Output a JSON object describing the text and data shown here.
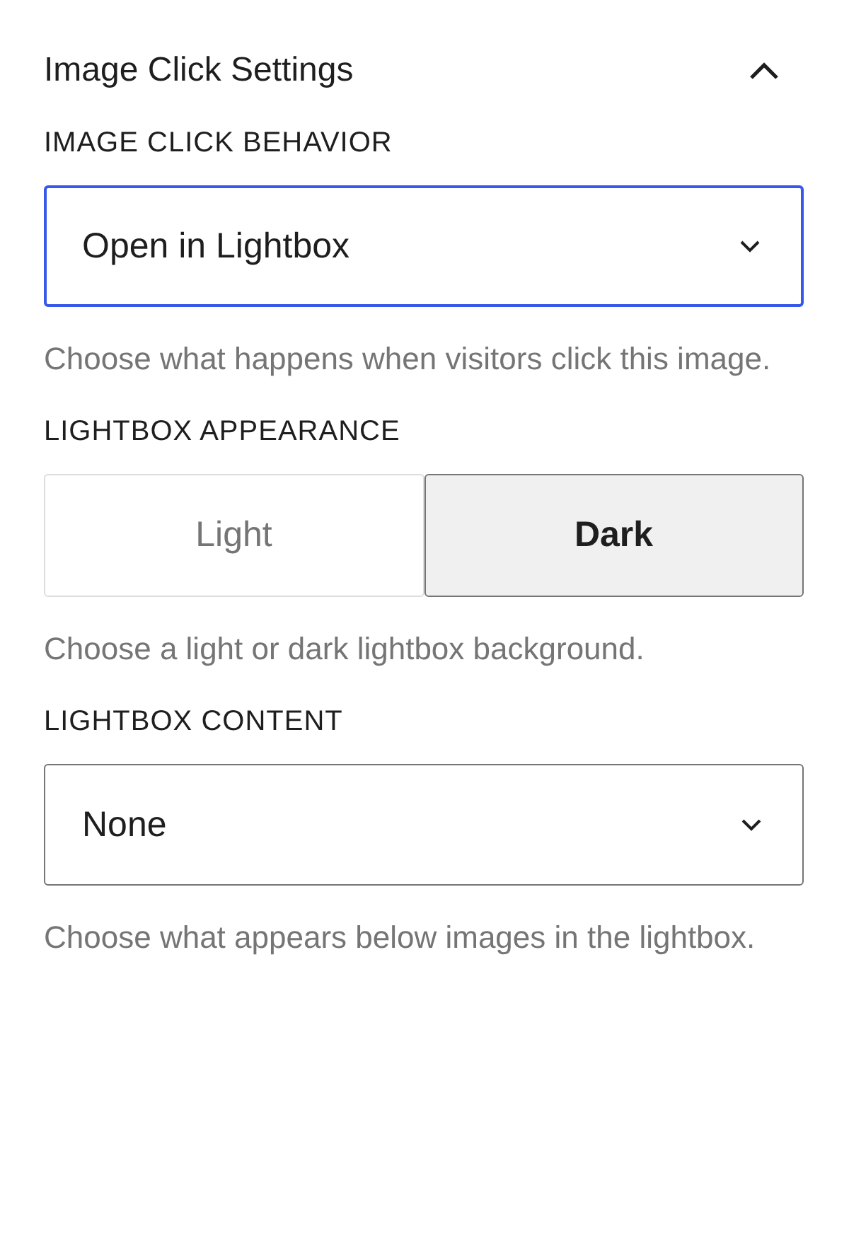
{
  "panel": {
    "title": "Image Click Settings",
    "expanded": true
  },
  "fields": [
    {
      "kind": "select",
      "label": "IMAGE CLICK BEHAVIOR",
      "value": "Open in Lightbox",
      "focused": true,
      "help": "Choose what happens when visitors click this image."
    },
    {
      "kind": "toggle",
      "label": "LIGHTBOX APPEARANCE",
      "options": [
        {
          "label": "Light",
          "selected": false
        },
        {
          "label": "Dark",
          "selected": true
        }
      ],
      "help": "Choose a light or dark lightbox background."
    },
    {
      "kind": "select",
      "label": "LIGHTBOX CONTENT",
      "value": "None",
      "focused": false,
      "help": "Choose what appears below images in the lightbox."
    }
  ]
}
